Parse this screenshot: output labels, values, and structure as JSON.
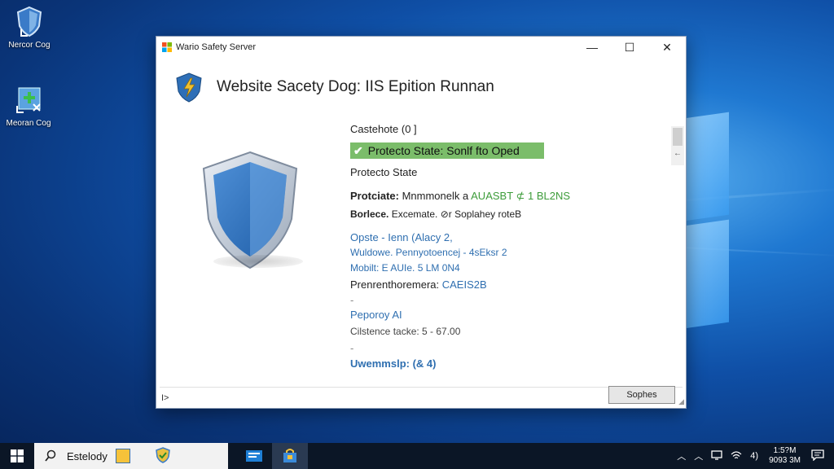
{
  "desktop": {
    "icons": [
      {
        "label": "Nercor Cog",
        "icon": "shield-icon"
      },
      {
        "label": "Meoran Cog",
        "icon": "network-icon"
      }
    ]
  },
  "window": {
    "title": "Wario Safety Server",
    "controls": {
      "minimize": "—",
      "maximize": "☐",
      "close": "✕"
    },
    "header_title": "Website Sacety Dog: IIS Epition Runnan",
    "info": {
      "castehote": "Castehote (0 ]",
      "green_status": "Protecto State: Sonlf fto Oped",
      "protecto_state": "Protecto State",
      "protciate_label": "Protciate:",
      "protciate_mid": "Mnmmonelk a",
      "protciate_value": "AUASBT ⊄ 1 BL2NS",
      "borlece_label": "Borlece.",
      "borlece_value": "Excemate. ⊘r Soplahey roteB",
      "opste": "Opste - Ienn (Alacy 2,",
      "wuldowe": "Wuldowe. Pennyotoencej - 4sEksr 2",
      "mobilt": "Mobilt: E AUIe. 5 LM 0N4",
      "prenrent_label": "Prenrenthoremera:",
      "prenrent_value": "CAEIS2B",
      "dash1": "-",
      "peporoy": "Peporoy AI",
      "cilstence": "Cilstence tacke: 5 - 67.00",
      "dash2": "-",
      "uwemmslp": "Uwemmslp: (& 4)"
    },
    "footer_left": "I>",
    "footer_button": "Sophes"
  },
  "taskbar": {
    "search_text": "Estelody",
    "tray_icons": [
      "chevron-up-icon",
      "chevron-up-icon",
      "monitor-icon",
      "wifi-icon",
      "volume-icon"
    ],
    "volume_text": "4)",
    "clock_time": "1:5?M",
    "clock_date": "9093 3M"
  },
  "colors": {
    "accent_green": "#7bbd6a",
    "link_blue": "#2f6fb0",
    "shield_blue": "#3a7bc8"
  }
}
